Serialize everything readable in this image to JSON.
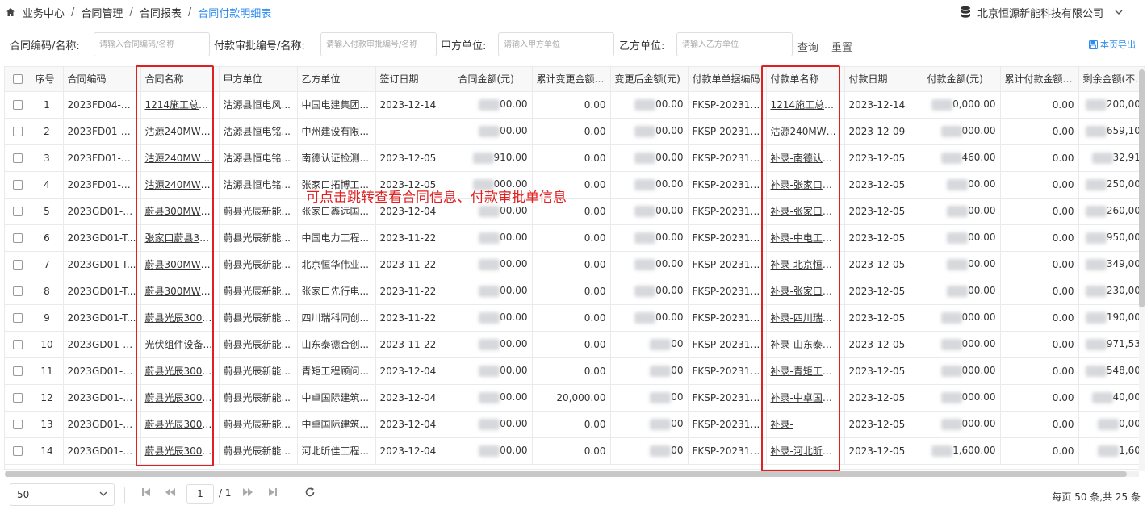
{
  "breadcrumb": [
    "业务中心",
    "合同管理",
    "合同报表",
    "合同付款明细表"
  ],
  "company": "北京恒源新能科技有限公司",
  "search": {
    "contract_label": "合同编码/名称:",
    "contract_placeholder": "请输入合同编码/名称",
    "payment_label": "付款审批编号/名称:",
    "payment_placeholder": "请输入付款审批编号/名称",
    "party_a_label": "甲方单位:",
    "party_a_placeholder": "请输入甲方单位",
    "party_b_label": "乙方单位:",
    "party_b_placeholder": "请输入乙方单位",
    "query_label": "查询",
    "reset_label": "重置",
    "export_label": "本页导出"
  },
  "table": {
    "columns": [
      "序号",
      "合同编码",
      "合同名称",
      "甲方单位",
      "乙方单位",
      "签订日期",
      "合同金额(元)",
      "累计变更金额(元)",
      "变更后金额(元)",
      "付款单单据编码",
      "付款单名称",
      "付款日期",
      "付款金额(元)",
      "累计付款金额(不含",
      "剩余金额(不含本"
    ],
    "rows": [
      [
        "1",
        "2023FD04-E&...",
        "1214施工总承...",
        "沽源县恒电风...",
        "中国电建集团...",
        "2023-12-14",
        "00.00",
        "0.00",
        "00.00",
        "FKSP-202312-...",
        "1214施工总承...",
        "2023-12-14",
        "0,000.00",
        "0.00",
        "200,000"
      ],
      [
        "2",
        "2023FD01-E&...",
        "沽源240MW风...",
        "沽源县恒电铭...",
        "中州建设有限...",
        "",
        "00.00",
        "0.00",
        "00.00",
        "FKSP-202312-...",
        "沽源240MW风...",
        "2023-12-09",
        "000.00",
        "0.00",
        "659,100"
      ],
      [
        "3",
        "2023FD01-E&...",
        "沽源240MW ...",
        "沽源县恒电铭...",
        "南德认证检测...",
        "2023-12-05",
        "910.00",
        "0.00",
        "00.00",
        "FKSP-202312-...",
        "补录-南德认证...",
        "2023-12-05",
        "460.00",
        "0.00",
        "32,910"
      ],
      [
        "4",
        "2023FD01-D...",
        "沽源240MW风...",
        "沽源县恒电铭...",
        "张家口拓博工...",
        "2023-12-05",
        "000.00",
        "0.00",
        "00.00",
        "FKSP-202312-...",
        "补录-张家口拓...",
        "2023-12-05",
        "00.00",
        "0.00",
        "250,000"
      ],
      [
        "5",
        "2023GD01-D...",
        "蔚县300MW光...",
        "蔚县光辰新能...",
        "张家口鑫远国...",
        "2023-12-04",
        "00.00",
        "0.00",
        "00.00",
        "FKSP-202312-...",
        "补录-张家口鑫...",
        "2023-12-05",
        "00.00",
        "0.00",
        "260,000"
      ],
      [
        "6",
        "2023GD01-T...",
        "张家口蔚县300...",
        "蔚县光辰新能...",
        "中国电力工程...",
        "2023-11-22",
        "00.00",
        "0.00",
        "00.00",
        "FKSP-202312-...",
        "补录-中电工程...",
        "2023-12-05",
        "00.00",
        "0.00",
        "950,000"
      ],
      [
        "7",
        "2023GD01-T...",
        "蔚县300MW光...",
        "蔚县光辰新能...",
        "北京恒华伟业...",
        "2023-11-22",
        "00.00",
        "0.00",
        "00.00",
        "FKSP-202312-...",
        "补录-北京恒华...",
        "2023-12-05",
        "00.00",
        "0.00",
        "349,000"
      ],
      [
        "8",
        "2023GD01-T...",
        "蔚县300MW光...",
        "蔚县光辰新能...",
        "张家口先行电...",
        "2023-11-22",
        "00.00",
        "0.00",
        "00.00",
        "FKSP-202312-...",
        "补录-张家口先...",
        "2023-12-05",
        "00.00",
        "0.00",
        "230,000"
      ],
      [
        "9",
        "2023GD01-T...",
        "蔚县光辰300M...",
        "蔚县光辰新能...",
        "四川瑞科同创...",
        "2023-11-22",
        "00.00",
        "0.00",
        "00.00",
        "FKSP-202312-...",
        "补录-四川瑞科...",
        "2023-12-05",
        "000.00",
        "0.00",
        "190,000"
      ],
      [
        "10",
        "2023GD01-P...",
        "光伏组件设备...",
        "蔚县光辰新能...",
        "山东泰德合创...",
        "2023-11-22",
        "00.00",
        "0.00",
        "00",
        "FKSP-202312-...",
        "补录-山东泰德...",
        "2023-12-05",
        "000.00",
        "0.00",
        "971,533"
      ],
      [
        "11",
        "2023GD01-O...",
        "蔚县光辰300M...",
        "蔚县光辰新能...",
        "青矩工程顾问...",
        "2023-12-04",
        "00.00",
        "0.00",
        "00",
        "FKSP-202312-...",
        "补录-青矩工程...",
        "2023-12-05",
        "000.00",
        "0.00",
        "548,000"
      ],
      [
        "12",
        "2023GD01-D...",
        "蔚县光辰300M...",
        "蔚县光辰新能...",
        "中卓国际建筑...",
        "2023-12-04",
        "00.00",
        "20,000.00",
        "00",
        "FKSP-202312-...",
        "补录-中卓国际...",
        "2023-12-05",
        "000.00",
        "0.00",
        "40,000"
      ],
      [
        "13",
        "2023GD01-D...",
        "蔚县光辰300M...",
        "蔚县光辰新能...",
        "中卓国际建筑...",
        "2023-12-04",
        "00.00",
        "0.00",
        "00",
        "FKSP-202312-...",
        "补录-",
        "2023-12-05",
        "000.00",
        "0.00",
        "0,000"
      ],
      [
        "14",
        "2023GD01-D...",
        "蔚县光辰300M...",
        "蔚县光辰新能...",
        "河北昕佳工程...",
        "2023-12-04",
        "00.00",
        "0.00",
        "00",
        "FKSP-202312-...",
        "补录-河北昕佳...",
        "2023-12-05",
        "1,600.00",
        "0.00",
        "1,600"
      ]
    ]
  },
  "annotation": "可点击跳转查看合同信息、付款审批单信息",
  "pager": {
    "page_size": "50",
    "current_page": "1",
    "total_pages": "/ 1",
    "summary": "每页 50 条,共 25 条"
  },
  "colors": {
    "accent": "#2d8cf0",
    "annotation": "#e02020"
  }
}
